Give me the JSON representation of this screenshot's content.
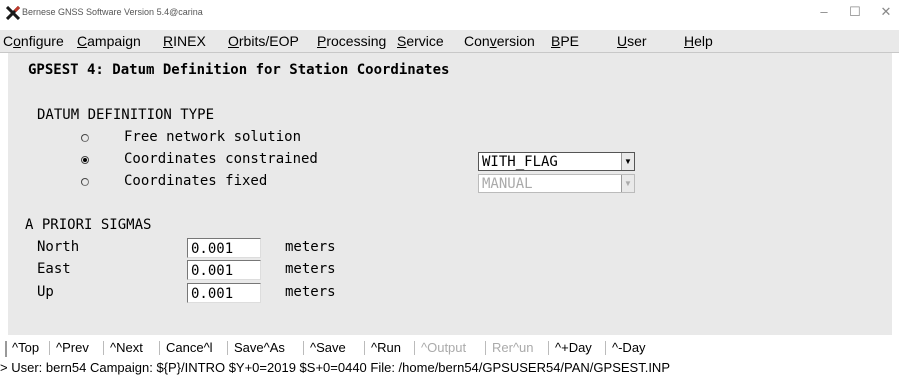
{
  "window": {
    "title": "Bernese GNSS Software Version 5.4@carina",
    "app_icon": "x-logo-icon",
    "controls": {
      "minimize": "–",
      "maximize": "☐",
      "close": "✕"
    }
  },
  "menu": [
    {
      "label": "Configure",
      "icon": ""
    },
    {
      "label": "Campaign"
    },
    {
      "label": "RINEX"
    },
    {
      "label": "Orbits/EOP"
    },
    {
      "label": "Processing"
    },
    {
      "label": "Service"
    },
    {
      "label": "Conversion"
    },
    {
      "label": "BPE"
    },
    {
      "label": "User"
    },
    {
      "label": "Help"
    }
  ],
  "panel": {
    "title": "GPSEST 4: Datum Definition for Station Coordinates",
    "datum_section": "DATUM DEFINITION TYPE",
    "options": [
      {
        "label": "Free network solution",
        "selected": false
      },
      {
        "label": "Coordinates constrained",
        "selected": true
      },
      {
        "label": "Coordinates fixed",
        "selected": false
      }
    ],
    "constrained_combo": {
      "value": "WITH_FLAG",
      "enabled": true
    },
    "fixed_combo": {
      "value": "MANUAL",
      "enabled": false
    },
    "sigma_section": "A PRIORI SIGMAS",
    "sigmas": [
      {
        "label": "North",
        "value": "0.001",
        "unit": "meters"
      },
      {
        "label": "East",
        "value": "0.001",
        "unit": "meters"
      },
      {
        "label": "Up",
        "value": "0.001",
        "unit": "meters"
      }
    ]
  },
  "buttons": [
    {
      "label": "^Top",
      "enabled": true
    },
    {
      "label": "^Prev",
      "enabled": true
    },
    {
      "label": "^Next",
      "enabled": true
    },
    {
      "label": "Cance^l",
      "enabled": true
    },
    {
      "label": "Save^As",
      "enabled": true
    },
    {
      "label": "^Save",
      "enabled": true
    },
    {
      "label": "^Run",
      "enabled": true
    },
    {
      "label": "^Output",
      "enabled": false
    },
    {
      "label": "Rer^un",
      "enabled": false
    },
    {
      "label": "^+Day",
      "enabled": true
    },
    {
      "label": "^-Day",
      "enabled": true
    }
  ],
  "status": "> User: bern54  Campaign: ${P}/INTRO  $Y+0=2019  $S+0=0440  File: /home/bern54/GPSUSER54/PAN/GPSEST.INP"
}
